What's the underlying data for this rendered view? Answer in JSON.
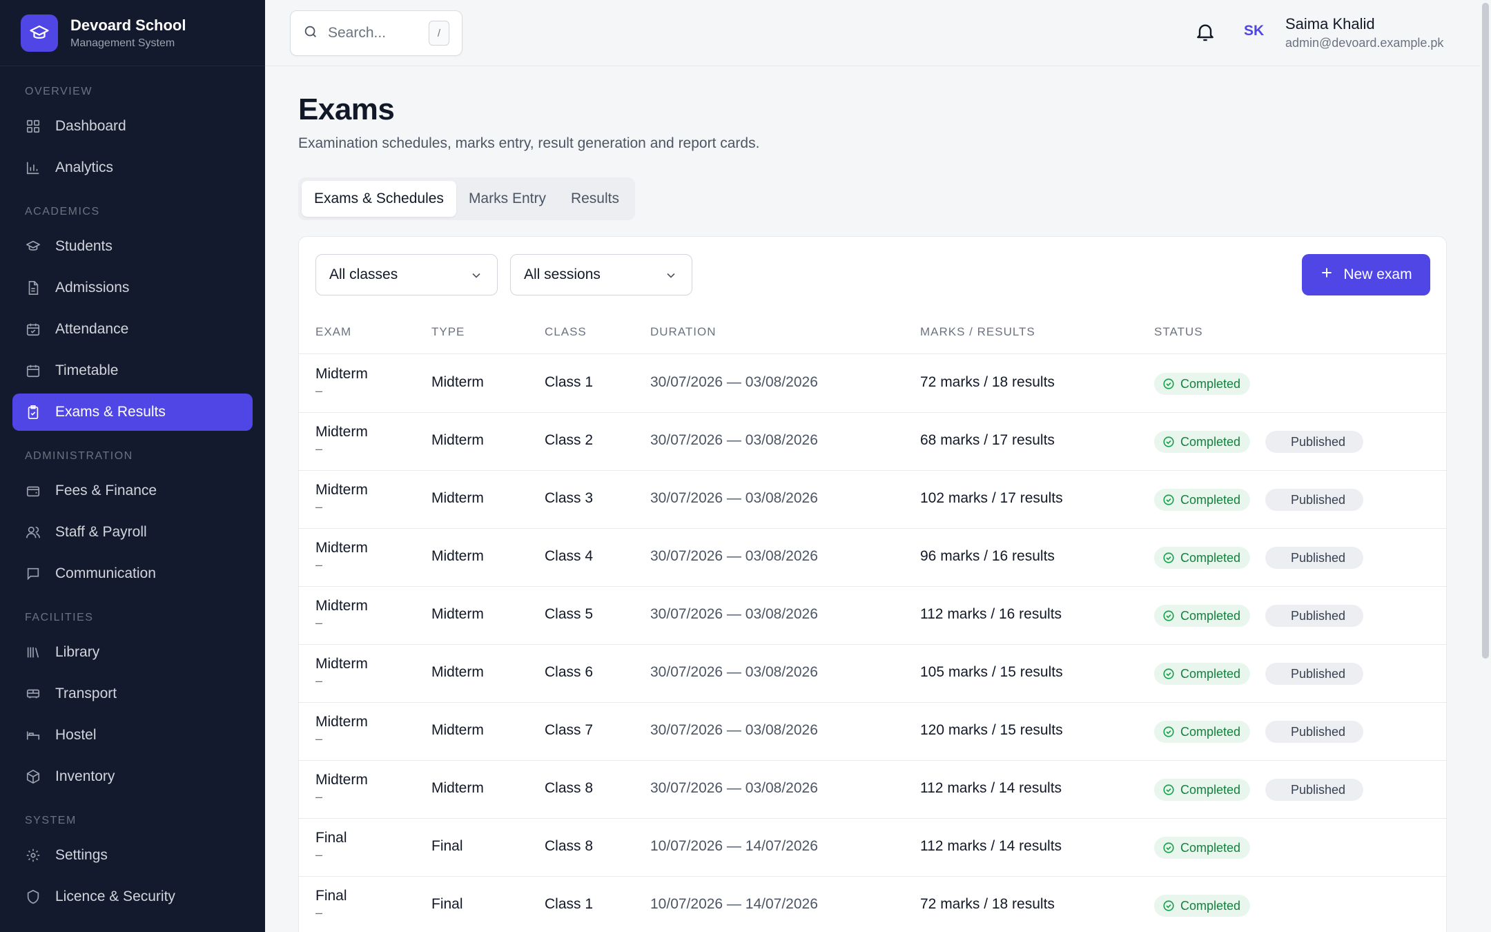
{
  "brand": {
    "name": "Devoard School",
    "subtitle": "Management System",
    "logo_icon": "graduation-cap-icon"
  },
  "sidebar": {
    "sections": [
      {
        "title": "OVERVIEW",
        "items": [
          {
            "label": "Dashboard",
            "icon": "grid-icon"
          },
          {
            "label": "Analytics",
            "icon": "bar-chart-icon"
          }
        ]
      },
      {
        "title": "ACADEMICS",
        "items": [
          {
            "label": "Students",
            "icon": "graduation-cap-icon"
          },
          {
            "label": "Admissions",
            "icon": "document-icon"
          },
          {
            "label": "Attendance",
            "icon": "calendar-check-icon"
          },
          {
            "label": "Timetable",
            "icon": "calendar-icon"
          },
          {
            "label": "Exams & Results",
            "icon": "clipboard-check-icon",
            "active": true
          }
        ]
      },
      {
        "title": "ADMINISTRATION",
        "items": [
          {
            "label": "Fees & Finance",
            "icon": "wallet-icon"
          },
          {
            "label": "Staff & Payroll",
            "icon": "users-icon"
          },
          {
            "label": "Communication",
            "icon": "message-icon"
          }
        ]
      },
      {
        "title": "FACILITIES",
        "items": [
          {
            "label": "Library",
            "icon": "library-icon"
          },
          {
            "label": "Transport",
            "icon": "bus-icon"
          },
          {
            "label": "Hostel",
            "icon": "bed-icon"
          },
          {
            "label": "Inventory",
            "icon": "package-icon"
          }
        ]
      },
      {
        "title": "SYSTEM",
        "items": [
          {
            "label": "Settings",
            "icon": "gear-icon"
          },
          {
            "label": "Licence & Security",
            "icon": "shield-icon"
          }
        ]
      }
    ]
  },
  "topbar": {
    "search_placeholder": "Search...",
    "search_shortcut": "/",
    "user": {
      "initials": "SK",
      "name": "Saima Khalid",
      "email": "admin@devoard.example.pk"
    }
  },
  "page": {
    "title": "Exams",
    "subtitle": "Examination schedules, marks entry, result generation and report cards."
  },
  "tabs": [
    {
      "label": "Exams & Schedules",
      "active": true
    },
    {
      "label": "Marks Entry",
      "active": false
    },
    {
      "label": "Results",
      "active": false
    }
  ],
  "filters": {
    "class_select": "All classes",
    "session_select": "All sessions"
  },
  "new_exam_label": "New exam",
  "table": {
    "columns": [
      "EXAM",
      "TYPE",
      "CLASS",
      "DURATION",
      "MARKS / RESULTS",
      "STATUS"
    ],
    "rows": [
      {
        "exam": "Midterm",
        "sub": "–",
        "type": "Midterm",
        "class": "Class 1",
        "duration": "30/07/2026 — 03/08/2026",
        "marks": "72 marks / 18 results",
        "status": "Completed",
        "published": ""
      },
      {
        "exam": "Midterm",
        "sub": "–",
        "type": "Midterm",
        "class": "Class 2",
        "duration": "30/07/2026 — 03/08/2026",
        "marks": "68 marks / 17 results",
        "status": "Completed",
        "published": "Published"
      },
      {
        "exam": "Midterm",
        "sub": "–",
        "type": "Midterm",
        "class": "Class 3",
        "duration": "30/07/2026 — 03/08/2026",
        "marks": "102 marks / 17 results",
        "status": "Completed",
        "published": "Published"
      },
      {
        "exam": "Midterm",
        "sub": "–",
        "type": "Midterm",
        "class": "Class 4",
        "duration": "30/07/2026 — 03/08/2026",
        "marks": "96 marks / 16 results",
        "status": "Completed",
        "published": "Published"
      },
      {
        "exam": "Midterm",
        "sub": "–",
        "type": "Midterm",
        "class": "Class 5",
        "duration": "30/07/2026 — 03/08/2026",
        "marks": "112 marks / 16 results",
        "status": "Completed",
        "published": "Published"
      },
      {
        "exam": "Midterm",
        "sub": "–",
        "type": "Midterm",
        "class": "Class 6",
        "duration": "30/07/2026 — 03/08/2026",
        "marks": "105 marks / 15 results",
        "status": "Completed",
        "published": "Published"
      },
      {
        "exam": "Midterm",
        "sub": "–",
        "type": "Midterm",
        "class": "Class 7",
        "duration": "30/07/2026 — 03/08/2026",
        "marks": "120 marks / 15 results",
        "status": "Completed",
        "published": "Published"
      },
      {
        "exam": "Midterm",
        "sub": "–",
        "type": "Midterm",
        "class": "Class 8",
        "duration": "30/07/2026 — 03/08/2026",
        "marks": "112 marks / 14 results",
        "status": "Completed",
        "published": "Published"
      },
      {
        "exam": "Final",
        "sub": "–",
        "type": "Final",
        "class": "Class 8",
        "duration": "10/07/2026 — 14/07/2026",
        "marks": "112 marks / 14 results",
        "status": "Completed",
        "published": ""
      },
      {
        "exam": "Final",
        "sub": "–",
        "type": "Final",
        "class": "Class 1",
        "duration": "10/07/2026 — 14/07/2026",
        "marks": "72 marks / 18 results",
        "status": "Completed",
        "published": ""
      }
    ]
  },
  "colors": {
    "accent": "#4f46e5",
    "sidebar_bg": "#141a2e",
    "completed_text": "#15803d",
    "completed_bg": "#e8f6ee",
    "published_bg": "#eceef1"
  }
}
